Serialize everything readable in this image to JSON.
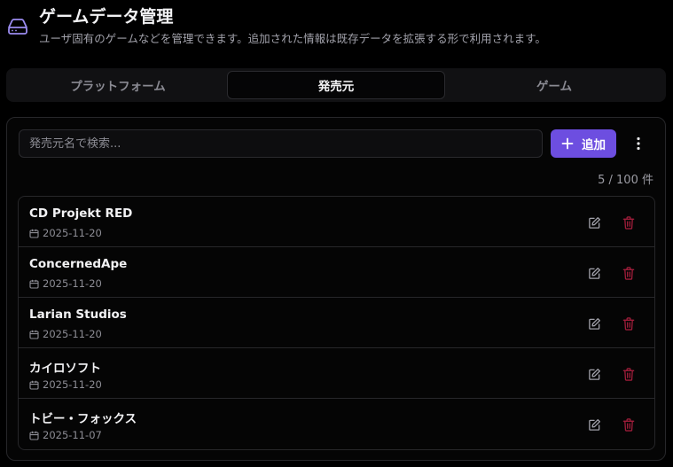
{
  "header": {
    "title": "ゲームデータ管理",
    "subtitle": "ユーザ固有のゲームなどを管理できます。追加された情報は既存データを拡張する形で利用されます。",
    "icon": "hard-drive-icon"
  },
  "tabs": [
    {
      "label": "プラットフォーム",
      "active": false
    },
    {
      "label": "発売元",
      "active": true
    },
    {
      "label": "ゲーム",
      "active": false
    }
  ],
  "search": {
    "placeholder": "発売元名で検索...",
    "value": ""
  },
  "add_button": {
    "label": "追加",
    "icon": "plus-icon"
  },
  "more_button": {
    "icon": "more-vertical-icon"
  },
  "count": "5 / 100 件",
  "publishers": [
    {
      "name": "CD Projekt RED",
      "date": "2025-11-20"
    },
    {
      "name": "ConcernedApe",
      "date": "2025-11-20"
    },
    {
      "name": "Larian Studios",
      "date": "2025-11-20"
    },
    {
      "name": "カイロソフト",
      "date": "2025-11-20"
    },
    {
      "name": "トビー・フォックス",
      "date": "2025-11-07"
    }
  ],
  "colors": {
    "accent": "#6d4ee0",
    "delete": "#9f1d3a",
    "icon_accent": "#9b8cf0"
  }
}
